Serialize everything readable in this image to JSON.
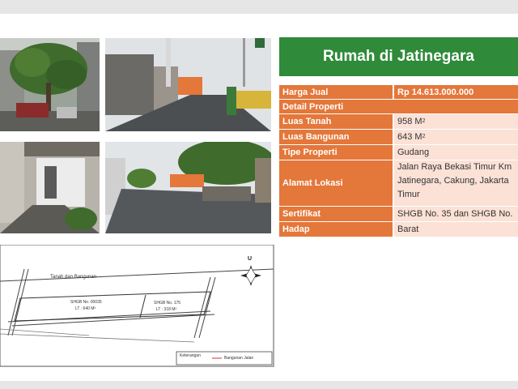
{
  "title": "Rumah di Jatinegara",
  "properties": [
    {
      "label": "Harga Jual",
      "value": "Rp 14.613.000.000"
    },
    {
      "label": "Detail Properti",
      "value": ""
    },
    {
      "label": "Luas Tanah",
      "value": "958 M",
      "sup": "2"
    },
    {
      "label": "Luas Bangunan",
      "value": "643 M",
      "sup": "2"
    },
    {
      "label": "Tipe Properti",
      "value": "Gudang"
    },
    {
      "label": "Alamat Lokasi",
      "value": "Jalan Raya Bekasi Timur Km Jatinegara, Cakung, Jakarta Timur"
    },
    {
      "label": "Sertifikat",
      "value": "SHGB No. 35 dan SHGB No."
    },
    {
      "label": "Hadap",
      "value": "Barat"
    }
  ],
  "map": {
    "heading": "Tanah dan Bangunan",
    "plot1": {
      "cert": "SHGB No. 00035",
      "area": "LT : 640 M²"
    },
    "plot2": {
      "cert": "SHGB No. 175",
      "area": "LT : 318 M²"
    },
    "legend": {
      "key": "Keterangan",
      "item": "Bangunan Jalan"
    },
    "compass": "U"
  },
  "colors": {
    "title_bg": "#2f8a3a",
    "label_bg": "#e4773a",
    "value_bg": "#fbe1d6"
  }
}
